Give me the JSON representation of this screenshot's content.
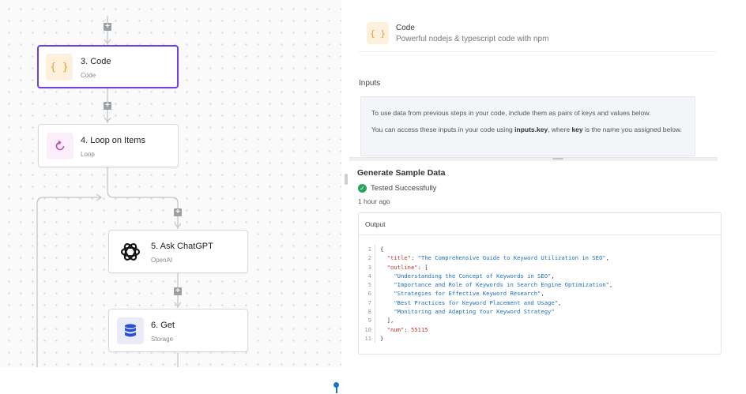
{
  "flow": {
    "nodes": [
      {
        "step": "3. Code",
        "type": "Code",
        "icon": "code-braces-icon",
        "selected": true
      },
      {
        "step": "4. Loop on Items",
        "type": "Loop",
        "icon": "loop-icon"
      },
      {
        "step": "5. Ask ChatGPT",
        "type": "OpenAI",
        "icon": "openai-icon"
      },
      {
        "step": "6. Get",
        "type": "Storage",
        "icon": "database-icon"
      }
    ],
    "add_symbol": "+"
  },
  "piece": {
    "icon_glyph": "{ }",
    "name": "Code",
    "description": "Powerful nodejs & typescript code with npm"
  },
  "inputs": {
    "label": "Inputs",
    "help_line1": "To use data from previous steps in your code, include them as pairs of keys and values below.",
    "help_line2_pre": "You can access these inputs in your code using ",
    "help_line2_code": "inputs.key",
    "help_line2_mid": ", where ",
    "help_line2_key": "key",
    "help_line2_post": " is the name you assigned below."
  },
  "sample": {
    "title": "Generate Sample Data",
    "status": "Tested Successfully",
    "time": "1 hour ago",
    "output_label": "Output",
    "lines": [
      {
        "n": "1",
        "parts": [
          [
            "p",
            "{"
          ]
        ]
      },
      {
        "n": "2",
        "parts": [
          [
            "p",
            "  "
          ],
          [
            "k",
            "\"title\""
          ],
          [
            "p",
            ": "
          ],
          [
            "s",
            "\"The Comprehensive Guide to Keyword Utilization in SEO\""
          ],
          [
            "p",
            ","
          ]
        ]
      },
      {
        "n": "3",
        "parts": [
          [
            "p",
            "  "
          ],
          [
            "k",
            "\"outline\""
          ],
          [
            "p",
            ": ["
          ]
        ]
      },
      {
        "n": "4",
        "parts": [
          [
            "p",
            "    "
          ],
          [
            "s",
            "\"Understanding the Concept of Keywords in SEO\""
          ],
          [
            "p",
            ","
          ]
        ]
      },
      {
        "n": "5",
        "parts": [
          [
            "p",
            "    "
          ],
          [
            "s",
            "\"Importance and Role of Keywords in Search Engine Optimization\""
          ],
          [
            "p",
            ","
          ]
        ]
      },
      {
        "n": "6",
        "parts": [
          [
            "p",
            "    "
          ],
          [
            "s",
            "\"Strategies for Effective Keyword Research\""
          ],
          [
            "p",
            ","
          ]
        ]
      },
      {
        "n": "7",
        "parts": [
          [
            "p",
            "    "
          ],
          [
            "s",
            "\"Best Practices for Keyword Placement and Usage\""
          ],
          [
            "p",
            ","
          ]
        ]
      },
      {
        "n": "8",
        "parts": [
          [
            "p",
            "    "
          ],
          [
            "s",
            "\"Monitoring and Adapting Your Keyword Strategy\""
          ]
        ]
      },
      {
        "n": "9",
        "parts": [
          [
            "p",
            "  ],"
          ]
        ]
      },
      {
        "n": "10",
        "parts": [
          [
            "p",
            "  "
          ],
          [
            "k",
            "\"num\""
          ],
          [
            "p",
            ": "
          ],
          [
            "n",
            "55115"
          ]
        ]
      },
      {
        "n": "11",
        "parts": [
          [
            "p",
            "}"
          ]
        ]
      }
    ]
  },
  "colors": {
    "accent": "#6e41e2",
    "success": "#25a35a",
    "marker": "#1677c9"
  }
}
